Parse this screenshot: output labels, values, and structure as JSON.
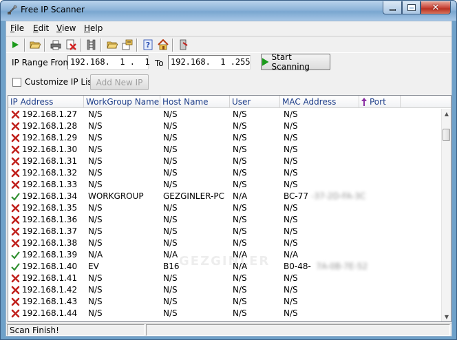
{
  "window": {
    "title": "Free IP Scanner"
  },
  "menu": [
    {
      "pre": "",
      "key": "F",
      "post": "ile"
    },
    {
      "pre": "",
      "key": "E",
      "post": "dit"
    },
    {
      "pre": "",
      "key": "V",
      "post": "iew"
    },
    {
      "pre": "",
      "key": "H",
      "post": "elp"
    }
  ],
  "toolbar_icons": [
    "play-icon",
    "open-folder-icon",
    "print-icon",
    "delete-icon",
    "network-icon",
    "folder-icon",
    "export-icon",
    "help-icon",
    "home-icon",
    "exit-icon"
  ],
  "range": {
    "from_label": "IP Range From",
    "from_value": "192.168.  1 .  1",
    "to_label": "To",
    "to_value": "192.168.  1 .255",
    "start_label": "Start Scanning"
  },
  "custom": {
    "checkbox_label": "Customize IP List",
    "add_label": "Add New IP"
  },
  "columns": [
    "IP Address",
    "WorkGroup Name",
    "Host Name",
    "User",
    "MAC Address",
    "Port"
  ],
  "rows": [
    {
      "status": "fail",
      "ip": "192.168.1.27",
      "wg": "N/S",
      "host": "N/S",
      "user": "N/S",
      "mac": "N/S",
      "mac_blur": ""
    },
    {
      "status": "fail",
      "ip": "192.168.1.28",
      "wg": "N/S",
      "host": "N/S",
      "user": "N/S",
      "mac": "N/S",
      "mac_blur": ""
    },
    {
      "status": "fail",
      "ip": "192.168.1.29",
      "wg": "N/S",
      "host": "N/S",
      "user": "N/S",
      "mac": "N/S",
      "mac_blur": ""
    },
    {
      "status": "fail",
      "ip": "192.168.1.30",
      "wg": "N/S",
      "host": "N/S",
      "user": "N/S",
      "mac": "N/S",
      "mac_blur": ""
    },
    {
      "status": "fail",
      "ip": "192.168.1.31",
      "wg": "N/S",
      "host": "N/S",
      "user": "N/S",
      "mac": "N/S",
      "mac_blur": ""
    },
    {
      "status": "fail",
      "ip": "192.168.1.32",
      "wg": "N/S",
      "host": "N/S",
      "user": "N/S",
      "mac": "N/S",
      "mac_blur": ""
    },
    {
      "status": "fail",
      "ip": "192.168.1.33",
      "wg": "N/S",
      "host": "N/S",
      "user": "N/S",
      "mac": "N/S",
      "mac_blur": ""
    },
    {
      "status": "ok",
      "ip": "192.168.1.34",
      "wg": "WORKGROUP",
      "host": "GEZGINLER-PC",
      "user": "N/A",
      "mac": "BC-77",
      "mac_blur": "-37-2D-FA-3C"
    },
    {
      "status": "fail",
      "ip": "192.168.1.35",
      "wg": "N/S",
      "host": "N/S",
      "user": "N/S",
      "mac": "N/S",
      "mac_blur": ""
    },
    {
      "status": "fail",
      "ip": "192.168.1.36",
      "wg": "N/S",
      "host": "N/S",
      "user": "N/S",
      "mac": "N/S",
      "mac_blur": ""
    },
    {
      "status": "fail",
      "ip": "192.168.1.37",
      "wg": "N/S",
      "host": "N/S",
      "user": "N/S",
      "mac": "N/S",
      "mac_blur": ""
    },
    {
      "status": "fail",
      "ip": "192.168.1.38",
      "wg": "N/S",
      "host": "N/S",
      "user": "N/S",
      "mac": "N/S",
      "mac_blur": ""
    },
    {
      "status": "ok",
      "ip": "192.168.1.39",
      "wg": "N/A",
      "host": "N/A",
      "user": "N/A",
      "mac": "N/A",
      "mac_blur": ""
    },
    {
      "status": "ok",
      "ip": "192.168.1.40",
      "wg": "EV",
      "host": "B16",
      "user": "N/A",
      "mac": "B0-48-",
      "mac_blur": "7A-0B-7E-52"
    },
    {
      "status": "fail",
      "ip": "192.168.1.41",
      "wg": "N/S",
      "host": "N/S",
      "user": "N/S",
      "mac": "N/S",
      "mac_blur": ""
    },
    {
      "status": "fail",
      "ip": "192.168.1.42",
      "wg": "N/S",
      "host": "N/S",
      "user": "N/S",
      "mac": "N/S",
      "mac_blur": ""
    },
    {
      "status": "fail",
      "ip": "192.168.1.43",
      "wg": "N/S",
      "host": "N/S",
      "user": "N/S",
      "mac": "N/S",
      "mac_blur": ""
    },
    {
      "status": "fail",
      "ip": "192.168.1.44",
      "wg": "N/S",
      "host": "N/S",
      "user": "N/S",
      "mac": "N/S",
      "mac_blur": ""
    }
  ],
  "status": {
    "text": "Scan Finish!"
  },
  "colors": {
    "fail": "#c0201c",
    "ok": "#2f8f2f",
    "header_text": "#1f3f8a",
    "title_bar": "#8db4d9"
  }
}
